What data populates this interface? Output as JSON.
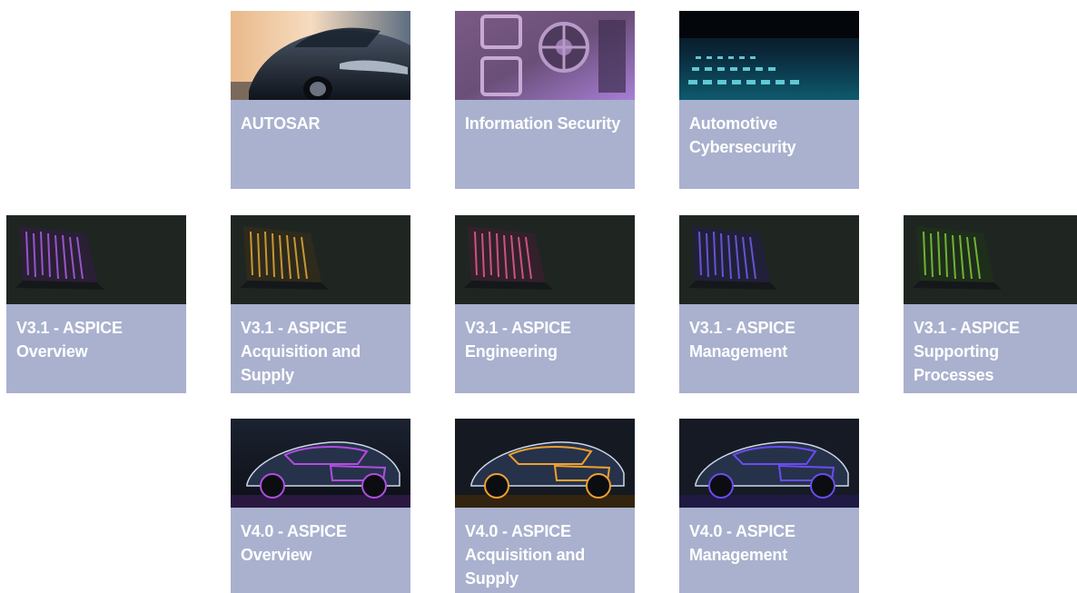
{
  "courses": [
    {
      "id": "autosar",
      "title": "AUTOSAR",
      "image": "sports-car-image"
    },
    {
      "id": "information-security",
      "title": "Information Security",
      "image": "bank-vault-image"
    },
    {
      "id": "automotive-cybersecurity",
      "title": "Automotive Cybersecurity",
      "image": "glowing-keyboard-image"
    },
    {
      "id": "v31-overview",
      "title": "V3.1 - ASPICE Overview",
      "image": "laptop-code-purple-image"
    },
    {
      "id": "v31-acquisition",
      "title": "V3.1 - ASPICE Acquisition and Supply",
      "image": "laptop-code-yellow-image"
    },
    {
      "id": "v31-engineering",
      "title": "V3.1 - ASPICE Engineering",
      "image": "laptop-code-pink-image"
    },
    {
      "id": "v31-management",
      "title": "V3.1 - ASPICE Management",
      "image": "laptop-code-blue-image"
    },
    {
      "id": "v31-supporting",
      "title": "V3.1 - ASPICE Supporting Processes",
      "image": "laptop-code-green-image"
    },
    {
      "id": "v40-overview",
      "title": "V4.0 - ASPICE Overview",
      "image": "wireframe-car-purple-image"
    },
    {
      "id": "v40-acquisition",
      "title": "V4.0 - ASPICE Acquisition and Supply",
      "image": "wireframe-car-orange-image"
    },
    {
      "id": "v40-management",
      "title": "V4.0 - ASPICE Management",
      "image": "wireframe-car-blue-image"
    }
  ],
  "colors": {
    "card_background": "#a9b1ce",
    "card_text": "#ffffff",
    "laptop_accents": [
      "#a35bd8",
      "#d9a335",
      "#d95b8a",
      "#6a5ce0",
      "#78c23a"
    ],
    "car_accents": [
      "#b04de0",
      "#f0a030",
      "#6a4cf0"
    ]
  }
}
